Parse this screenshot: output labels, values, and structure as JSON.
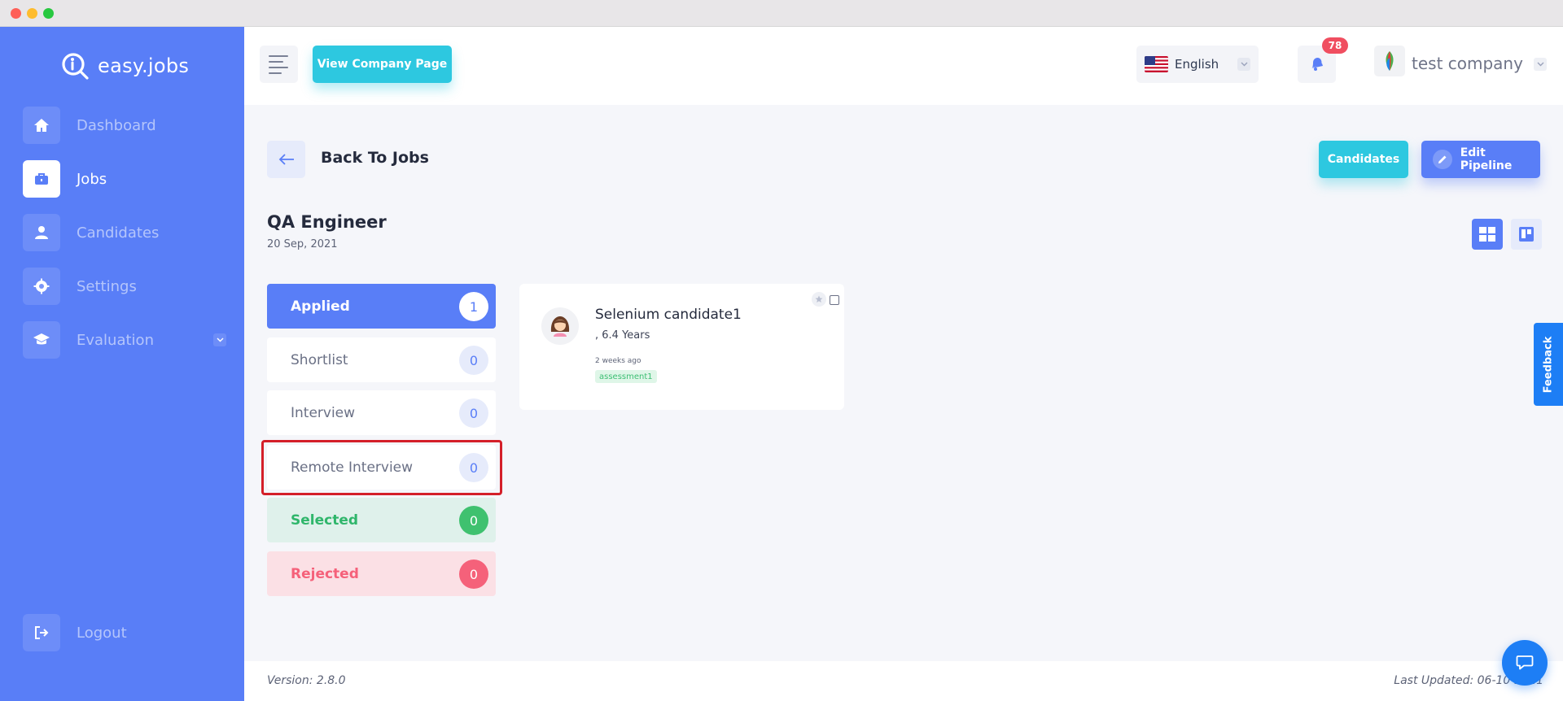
{
  "brand": {
    "name": "easy.jobs"
  },
  "sidebar": {
    "items": [
      {
        "label": "Dashboard",
        "icon": "home-icon"
      },
      {
        "label": "Jobs",
        "icon": "briefcase-icon",
        "active": true
      },
      {
        "label": "Candidates",
        "icon": "user-icon"
      },
      {
        "label": "Settings",
        "icon": "gear-icon"
      },
      {
        "label": "Evaluation",
        "icon": "graduation-cap-icon"
      }
    ],
    "logout": "Logout"
  },
  "header": {
    "company_page_label": "View Company Page",
    "language": "English",
    "notification_count": "78",
    "company_name": "test company"
  },
  "page": {
    "back_label": "Back To Jobs",
    "candidates_button": "Candidates",
    "edit_pipeline_button": "Edit Pipeline",
    "job_title": "QA Engineer",
    "job_date": "20 Sep, 2021"
  },
  "stages": [
    {
      "label": "Applied",
      "count": "1"
    },
    {
      "label": "Shortlist",
      "count": "0"
    },
    {
      "label": "Interview",
      "count": "0"
    },
    {
      "label": "Remote Interview",
      "count": "0"
    },
    {
      "label": "Selected",
      "count": "0"
    },
    {
      "label": "Rejected",
      "count": "0"
    }
  ],
  "candidate": {
    "name": "Selenium candidate1",
    "experience": ", 6.4 Years",
    "time": "2 weeks ago",
    "tag": "assessment1"
  },
  "feedback_label": "Feedback",
  "footer": {
    "version": "Version: 2.8.0",
    "last_updated": "Last Updated: 06-10-2021"
  },
  "colors": {
    "primary": "#597ef7",
    "accent": "#2dc8e0",
    "success": "#3fc16f",
    "danger": "#f5617a",
    "highlight": "#d41f29"
  }
}
